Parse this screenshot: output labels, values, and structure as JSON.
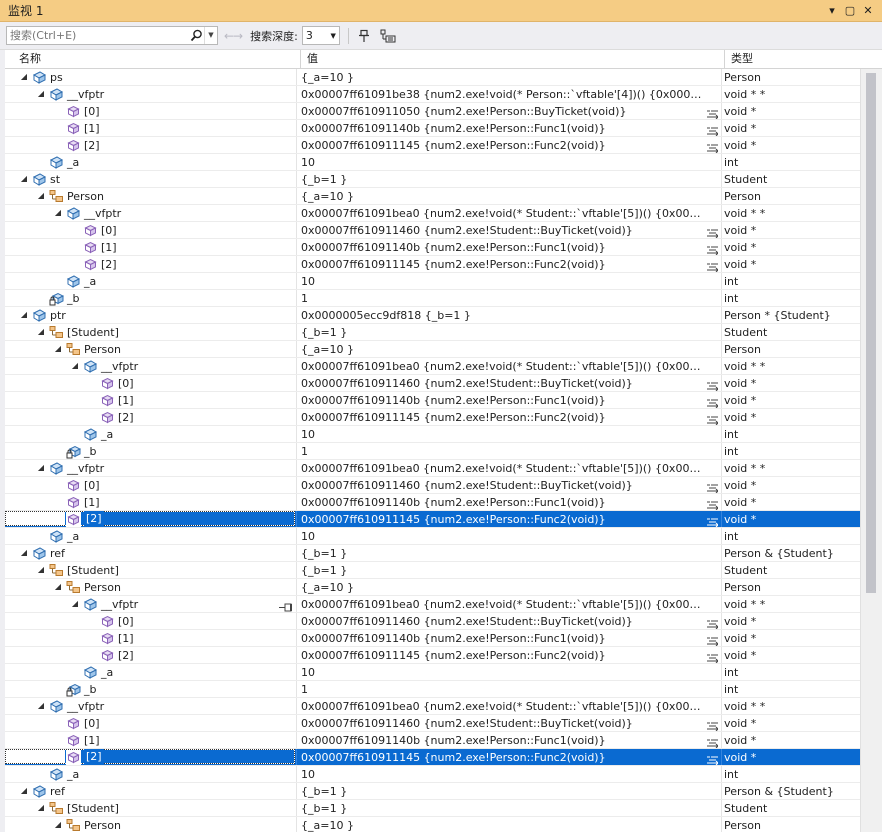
{
  "window": {
    "title": "监视 1",
    "controls": [
      "▾",
      "▢",
      "✕"
    ]
  },
  "toolbar": {
    "search_placeholder": "搜索(Ctrl+E)",
    "nav_label": "←→",
    "depth_label": "搜索深度:",
    "depth_value": "3"
  },
  "columns": {
    "name": "名称",
    "value": "值",
    "type": "类型"
  },
  "colors": {
    "selected_row": "#0a6ad1",
    "title_bar": "#f5cc84"
  },
  "rows": [
    {
      "depth": 0,
      "exp": "expanded",
      "icon": "field-icon",
      "name": "ps",
      "value": "{_a=10 }",
      "type": "Person"
    },
    {
      "depth": 1,
      "exp": "expanded",
      "icon": "field-icon",
      "name": "__vfptr",
      "value": "0x00007ff61091be38 {num2.exe!void(* Person::`vftable'[4])() {0x00007ff610911...",
      "type": "void * *"
    },
    {
      "depth": 2,
      "exp": "none",
      "icon": "element-icon",
      "name": "[0]",
      "value": "0x00007ff610911050 {num2.exe!Person::BuyTicket(void)}",
      "type": "void *",
      "vis": true
    },
    {
      "depth": 2,
      "exp": "none",
      "icon": "element-icon",
      "name": "[1]",
      "value": "0x00007ff61091140b {num2.exe!Person::Func1(void)}",
      "type": "void *",
      "vis": true
    },
    {
      "depth": 2,
      "exp": "none",
      "icon": "element-icon",
      "name": "[2]",
      "value": "0x00007ff610911145 {num2.exe!Person::Func2(void)}",
      "type": "void *",
      "vis": true
    },
    {
      "depth": 1,
      "exp": "none",
      "icon": "field-icon",
      "name": "_a",
      "value": "10",
      "type": "int"
    },
    {
      "depth": 0,
      "exp": "expanded",
      "icon": "field-icon",
      "name": "st",
      "value": "{_b=1 }",
      "type": "Student"
    },
    {
      "depth": 1,
      "exp": "expanded",
      "icon": "base-class-icon",
      "name": "Person",
      "value": "{_a=10 }",
      "type": "Person"
    },
    {
      "depth": 2,
      "exp": "expanded",
      "icon": "field-icon",
      "name": "__vfptr",
      "value": "0x00007ff61091bea0 {num2.exe!void(* Student::`vftable'[5])() {0x00007ff61091...",
      "type": "void * *"
    },
    {
      "depth": 3,
      "exp": "none",
      "icon": "element-icon",
      "name": "[0]",
      "value": "0x00007ff610911460 {num2.exe!Student::BuyTicket(void)}",
      "type": "void *",
      "vis": true
    },
    {
      "depth": 3,
      "exp": "none",
      "icon": "element-icon",
      "name": "[1]",
      "value": "0x00007ff61091140b {num2.exe!Person::Func1(void)}",
      "type": "void *",
      "vis": true
    },
    {
      "depth": 3,
      "exp": "none",
      "icon": "element-icon",
      "name": "[2]",
      "value": "0x00007ff610911145 {num2.exe!Person::Func2(void)}",
      "type": "void *",
      "vis": true
    },
    {
      "depth": 2,
      "exp": "none",
      "icon": "field-icon",
      "name": "_a",
      "value": "10",
      "type": "int"
    },
    {
      "depth": 1,
      "exp": "none",
      "icon": "private-field-icon",
      "name": "_b",
      "value": "1",
      "type": "int"
    },
    {
      "depth": 0,
      "exp": "expanded",
      "icon": "field-icon",
      "name": "ptr",
      "value": "0x0000005ecc9df818 {_b=1 }",
      "type": "Person * {Student}"
    },
    {
      "depth": 1,
      "exp": "expanded",
      "icon": "base-class-icon",
      "name": "[Student]",
      "value": "{_b=1 }",
      "type": "Student"
    },
    {
      "depth": 2,
      "exp": "expanded",
      "icon": "base-class-icon",
      "name": "Person",
      "value": "{_a=10 }",
      "type": "Person"
    },
    {
      "depth": 3,
      "exp": "expanded",
      "icon": "field-icon",
      "name": "__vfptr",
      "value": "0x00007ff61091bea0 {num2.exe!void(* Student::`vftable'[5])() {0x00007ff61091...",
      "type": "void * *"
    },
    {
      "depth": 4,
      "exp": "none",
      "icon": "element-icon",
      "name": "[0]",
      "value": "0x00007ff610911460 {num2.exe!Student::BuyTicket(void)}",
      "type": "void *",
      "vis": true
    },
    {
      "depth": 4,
      "exp": "none",
      "icon": "element-icon",
      "name": "[1]",
      "value": "0x00007ff61091140b {num2.exe!Person::Func1(void)}",
      "type": "void *",
      "vis": true
    },
    {
      "depth": 4,
      "exp": "none",
      "icon": "element-icon",
      "name": "[2]",
      "value": "0x00007ff610911145 {num2.exe!Person::Func2(void)}",
      "type": "void *",
      "vis": true
    },
    {
      "depth": 3,
      "exp": "none",
      "icon": "field-icon",
      "name": "_a",
      "value": "10",
      "type": "int"
    },
    {
      "depth": 2,
      "exp": "none",
      "icon": "private-field-icon",
      "name": "_b",
      "value": "1",
      "type": "int"
    },
    {
      "depth": 1,
      "exp": "expanded",
      "icon": "field-icon",
      "name": "__vfptr",
      "value": "0x00007ff61091bea0 {num2.exe!void(* Student::`vftable'[5])() {0x00007ff61091...",
      "type": "void * *"
    },
    {
      "depth": 2,
      "exp": "none",
      "icon": "element-icon",
      "name": "[0]",
      "value": "0x00007ff610911460 {num2.exe!Student::BuyTicket(void)}",
      "type": "void *",
      "vis": true
    },
    {
      "depth": 2,
      "exp": "none",
      "icon": "element-icon",
      "name": "[1]",
      "value": "0x00007ff61091140b {num2.exe!Person::Func1(void)}",
      "type": "void *",
      "vis": true
    },
    {
      "depth": 2,
      "exp": "none",
      "icon": "element-icon",
      "name": "[2]",
      "value": "0x00007ff610911145 {num2.exe!Person::Func2(void)}",
      "type": "void *",
      "vis": true,
      "selected": true
    },
    {
      "depth": 1,
      "exp": "none",
      "icon": "field-icon",
      "name": "_a",
      "value": "10",
      "type": "int"
    },
    {
      "depth": 0,
      "exp": "expanded",
      "icon": "field-icon",
      "name": "ref",
      "value": "{_b=1 }",
      "type": "Person & {Student}"
    },
    {
      "depth": 1,
      "exp": "expanded",
      "icon": "base-class-icon",
      "name": "[Student]",
      "value": "{_b=1 }",
      "type": "Student"
    },
    {
      "depth": 2,
      "exp": "expanded",
      "icon": "base-class-icon",
      "name": "Person",
      "value": "{_a=10 }",
      "type": "Person"
    },
    {
      "depth": 3,
      "exp": "expanded",
      "icon": "field-icon",
      "name": "__vfptr",
      "value": "0x00007ff61091bea0 {num2.exe!void(* Student::`vftable'[5])() {0x00007ff61091...",
      "type": "void * *",
      "pin": true
    },
    {
      "depth": 4,
      "exp": "none",
      "icon": "element-icon",
      "name": "[0]",
      "value": "0x00007ff610911460 {num2.exe!Student::BuyTicket(void)}",
      "type": "void *",
      "vis": true
    },
    {
      "depth": 4,
      "exp": "none",
      "icon": "element-icon",
      "name": "[1]",
      "value": "0x00007ff61091140b {num2.exe!Person::Func1(void)}",
      "type": "void *",
      "vis": true
    },
    {
      "depth": 4,
      "exp": "none",
      "icon": "element-icon",
      "name": "[2]",
      "value": "0x00007ff610911145 {num2.exe!Person::Func2(void)}",
      "type": "void *",
      "vis": true
    },
    {
      "depth": 3,
      "exp": "none",
      "icon": "field-icon",
      "name": "_a",
      "value": "10",
      "type": "int"
    },
    {
      "depth": 2,
      "exp": "none",
      "icon": "private-field-icon",
      "name": "_b",
      "value": "1",
      "type": "int"
    },
    {
      "depth": 1,
      "exp": "expanded",
      "icon": "field-icon",
      "name": "__vfptr",
      "value": "0x00007ff61091bea0 {num2.exe!void(* Student::`vftable'[5])() {0x00007ff61091...",
      "type": "void * *"
    },
    {
      "depth": 2,
      "exp": "none",
      "icon": "element-icon",
      "name": "[0]",
      "value": "0x00007ff610911460 {num2.exe!Student::BuyTicket(void)}",
      "type": "void *",
      "vis": true
    },
    {
      "depth": 2,
      "exp": "none",
      "icon": "element-icon",
      "name": "[1]",
      "value": "0x00007ff61091140b {num2.exe!Person::Func1(void)}",
      "type": "void *",
      "vis": true
    },
    {
      "depth": 2,
      "exp": "none",
      "icon": "element-icon",
      "name": "[2]",
      "value": "0x00007ff610911145 {num2.exe!Person::Func2(void)}",
      "type": "void *",
      "vis": true,
      "selected": true
    },
    {
      "depth": 1,
      "exp": "none",
      "icon": "field-icon",
      "name": "_a",
      "value": "10",
      "type": "int"
    },
    {
      "depth": 0,
      "exp": "expanded",
      "icon": "field-icon",
      "name": "ref",
      "value": "{_b=1 }",
      "type": "Person & {Student}"
    },
    {
      "depth": 1,
      "exp": "expanded",
      "icon": "base-class-icon",
      "name": "[Student]",
      "value": "{_b=1 }",
      "type": "Student"
    },
    {
      "depth": 2,
      "exp": "expanded",
      "icon": "base-class-icon",
      "name": "Person",
      "value": "{_a=10 }",
      "type": "Person"
    }
  ]
}
